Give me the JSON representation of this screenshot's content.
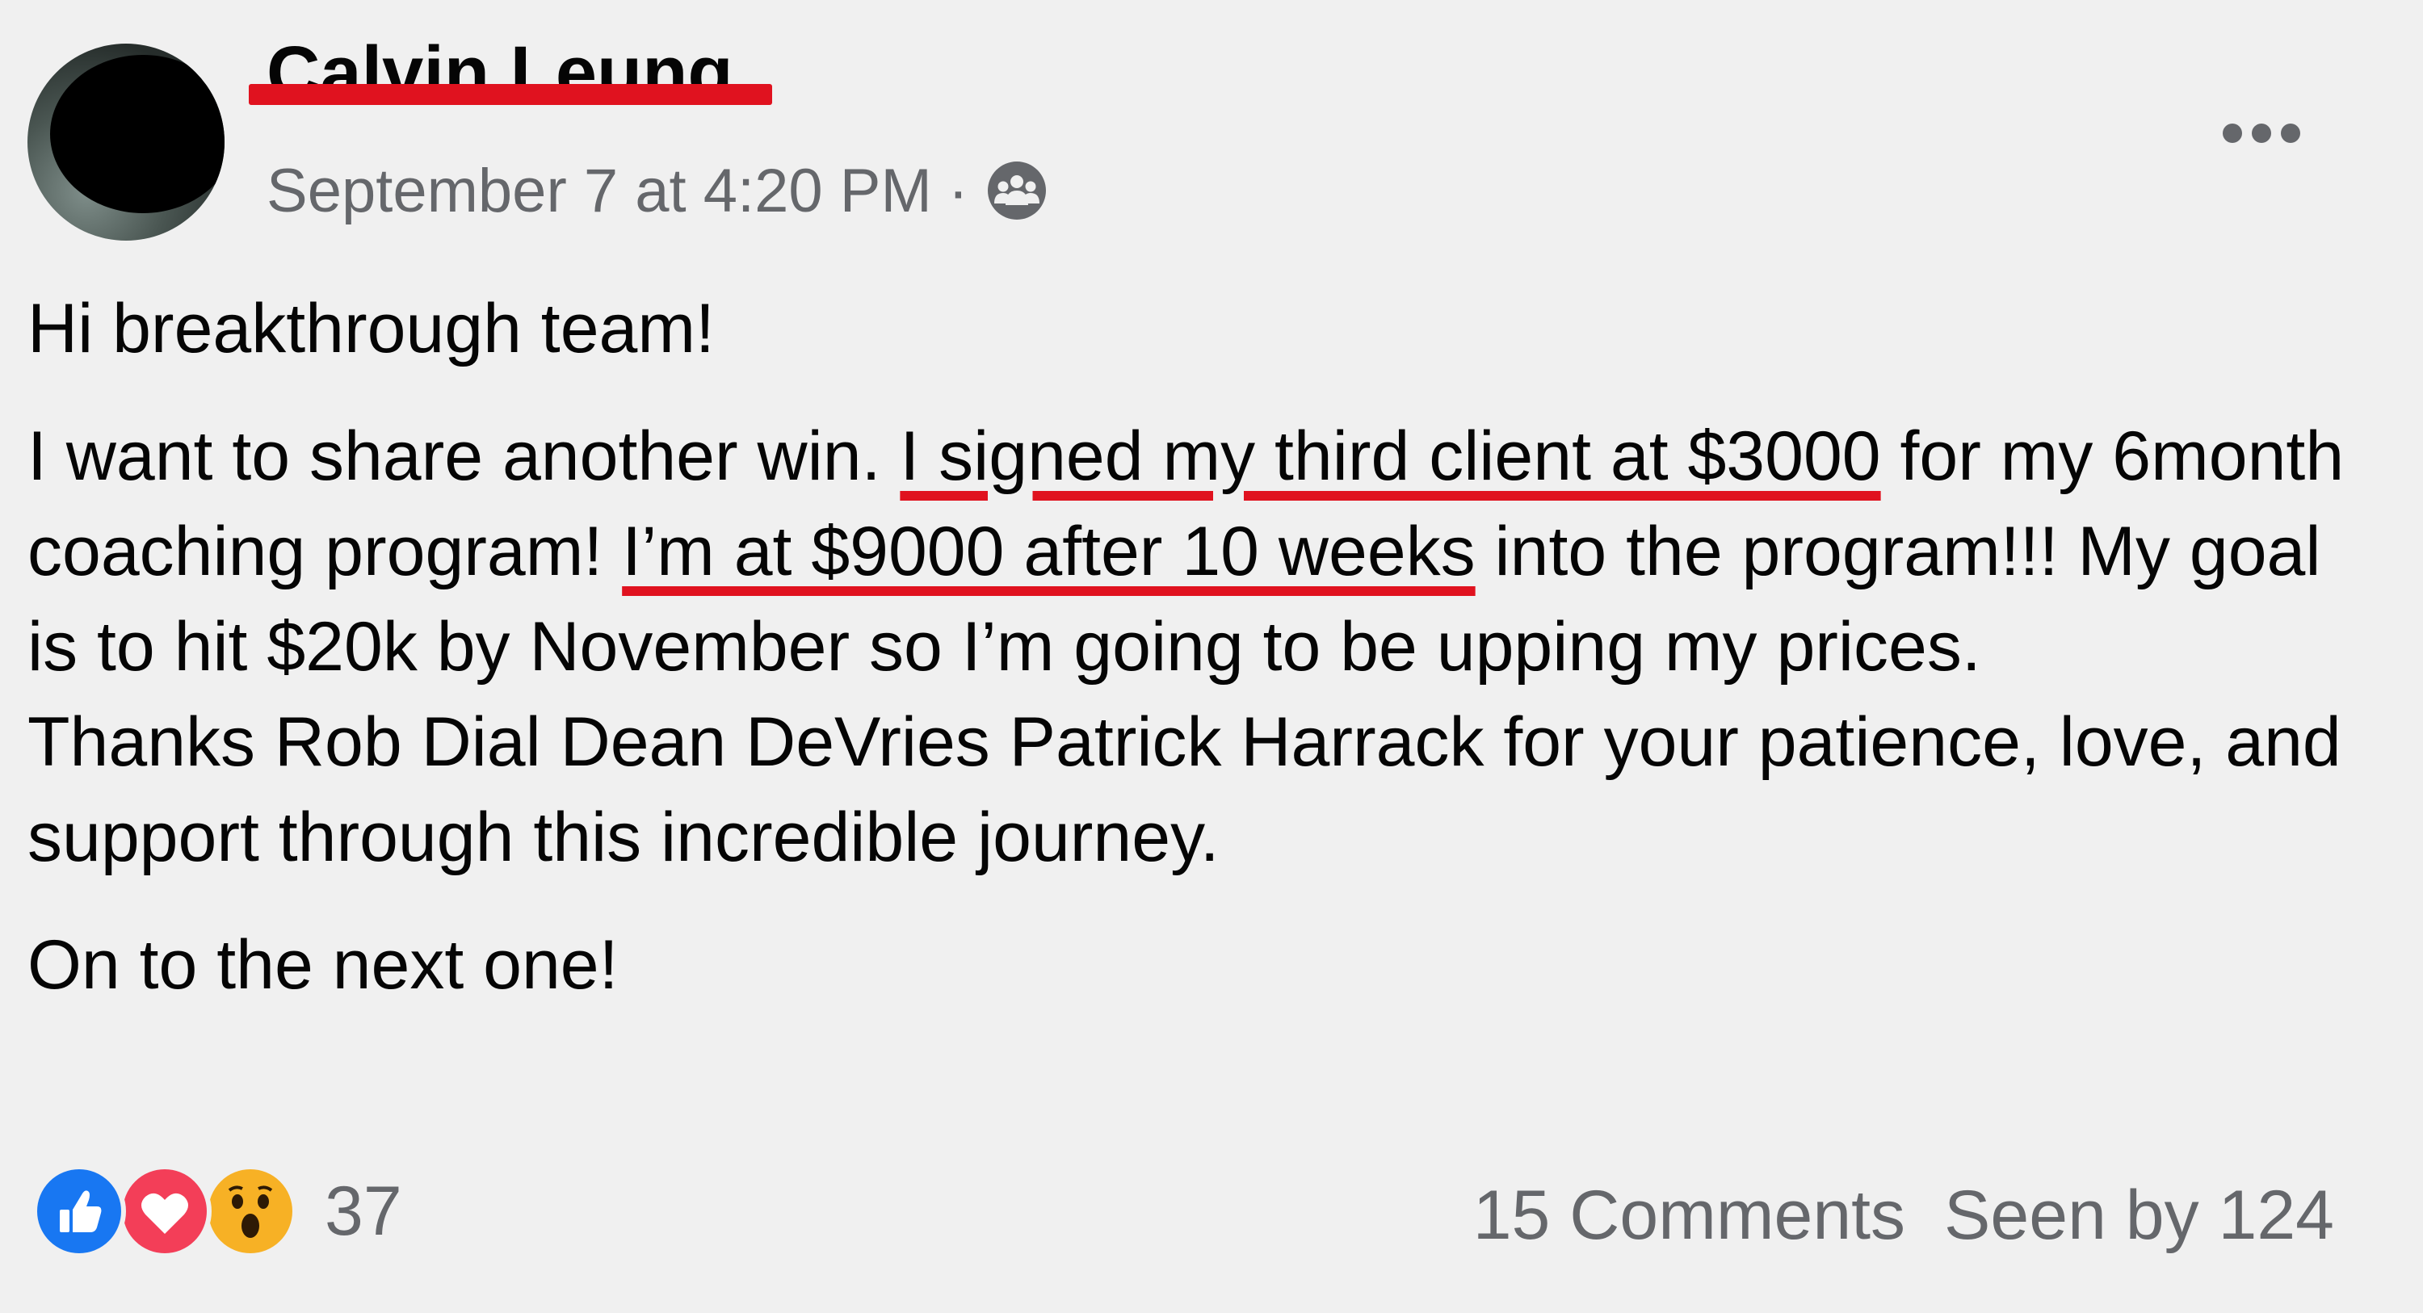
{
  "post": {
    "author_name": "Calvin Leung",
    "timestamp": "September 7 at 4:20 PM",
    "separator": "·",
    "audience_icon": "group-audience-icon",
    "more_icon": "more-horizontal-icon",
    "body": {
      "greeting": "Hi breakthrough team!",
      "win_intro": "I want to share another win. ",
      "highlight_1": "I signed my third client at $3000",
      "mid_text": " for my 6month coaching program! ",
      "highlight_2": "I’m at $9000 after 10 weeks",
      "goal_text": " into the program!!! My goal is to hit $20k by November so I’m going to be upping my prices.",
      "thanks": "Thanks Rob Dial Dean DeVries Patrick Harrack for your patience, love, and support through this incredible journey.",
      "closing": "On to the next one!"
    },
    "reactions": {
      "icons": [
        "like-icon",
        "love-icon",
        "wow-icon"
      ],
      "count": "37"
    },
    "comments_label": "15 Comments",
    "seen_label": "Seen by 124",
    "colors": {
      "redaction": "#e0121f",
      "secondary_text": "#65676b",
      "like_blue": "#1877f2",
      "love_red": "#f33e58",
      "wow_yellow": "#f7b125",
      "background": "#f0f0f0"
    }
  }
}
